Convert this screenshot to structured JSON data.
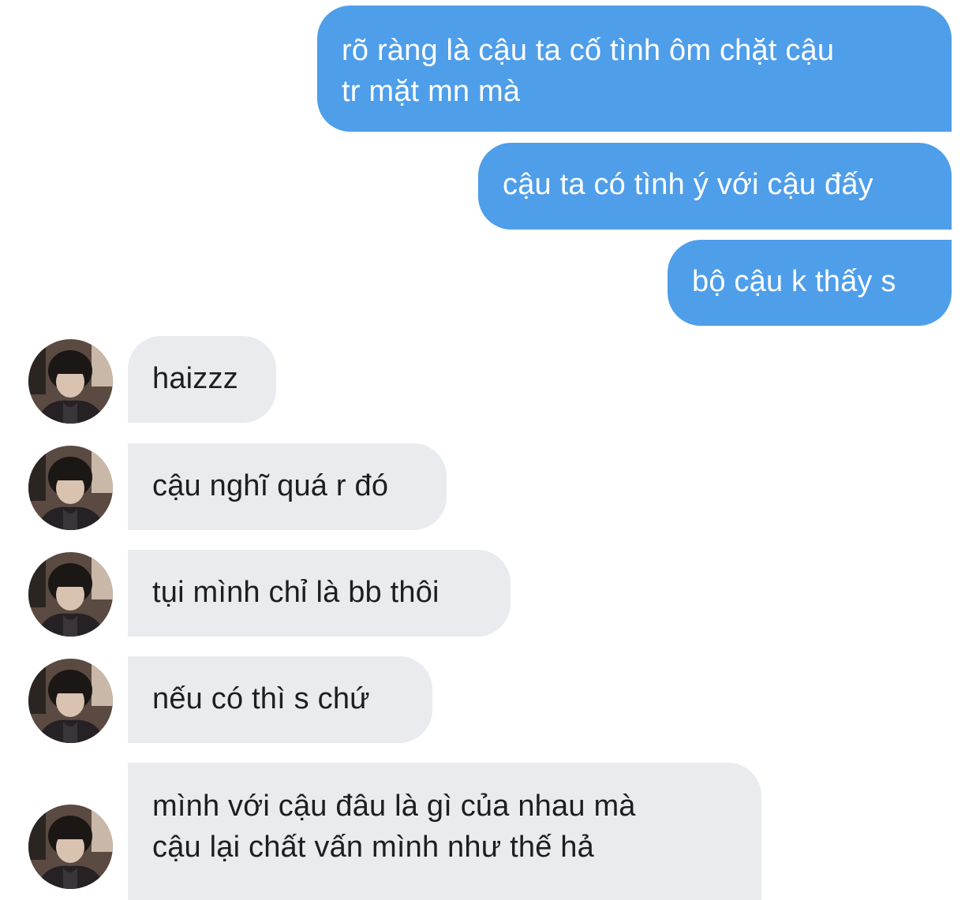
{
  "conversation": {
    "messages": [
      {
        "direction": "outgoing",
        "text": "rõ ràng là cậu ta cố tình ôm chặt cậu\ntr mặt mn mà"
      },
      {
        "direction": "outgoing",
        "text": "cậu ta có tình ý với cậu đấy"
      },
      {
        "direction": "outgoing",
        "text": "bộ cậu k thấy s"
      },
      {
        "direction": "incoming",
        "text": "haizzz"
      },
      {
        "direction": "incoming",
        "text": "cậu nghĩ quá r đó"
      },
      {
        "direction": "incoming",
        "text": "tụi mình chỉ là bb thôi"
      },
      {
        "direction": "incoming",
        "text": "nếu có thì s chứ"
      },
      {
        "direction": "incoming",
        "text": "mình với cậu đâu là gì của nhau mà\ncậu lại chất vấn mình như thế hả"
      }
    ]
  },
  "colors": {
    "outgoing_bubble": "#4e9eea",
    "incoming_bubble": "#e9ebee",
    "outgoing_text": "#ffffff",
    "incoming_text": "#1c1e21"
  }
}
